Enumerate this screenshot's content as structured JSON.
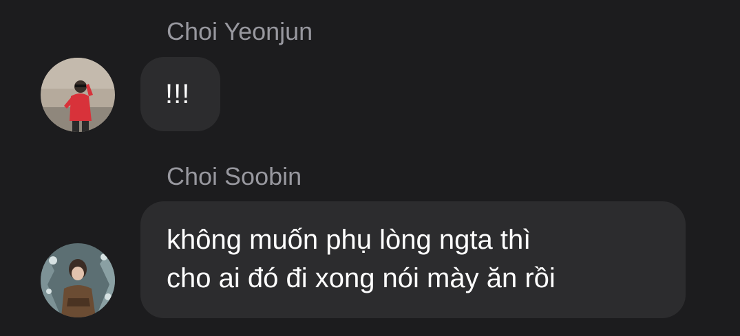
{
  "messages": [
    {
      "sender": "Choi Yeonjun",
      "avatar_icon": "user-avatar-photo-red-sweater",
      "lines": [
        "!!!"
      ]
    },
    {
      "sender": "Choi Soobin",
      "avatar_icon": "user-avatar-photo-snowy-trees",
      "lines": [
        "không muốn phụ lòng ngta thì",
        "cho ai đó đi xong nói mày ăn rồi"
      ]
    }
  ],
  "colors": {
    "background": "#1c1c1e",
    "bubble": "#2c2c2e",
    "sender_name": "#98989f",
    "message_text": "#ffffff"
  }
}
